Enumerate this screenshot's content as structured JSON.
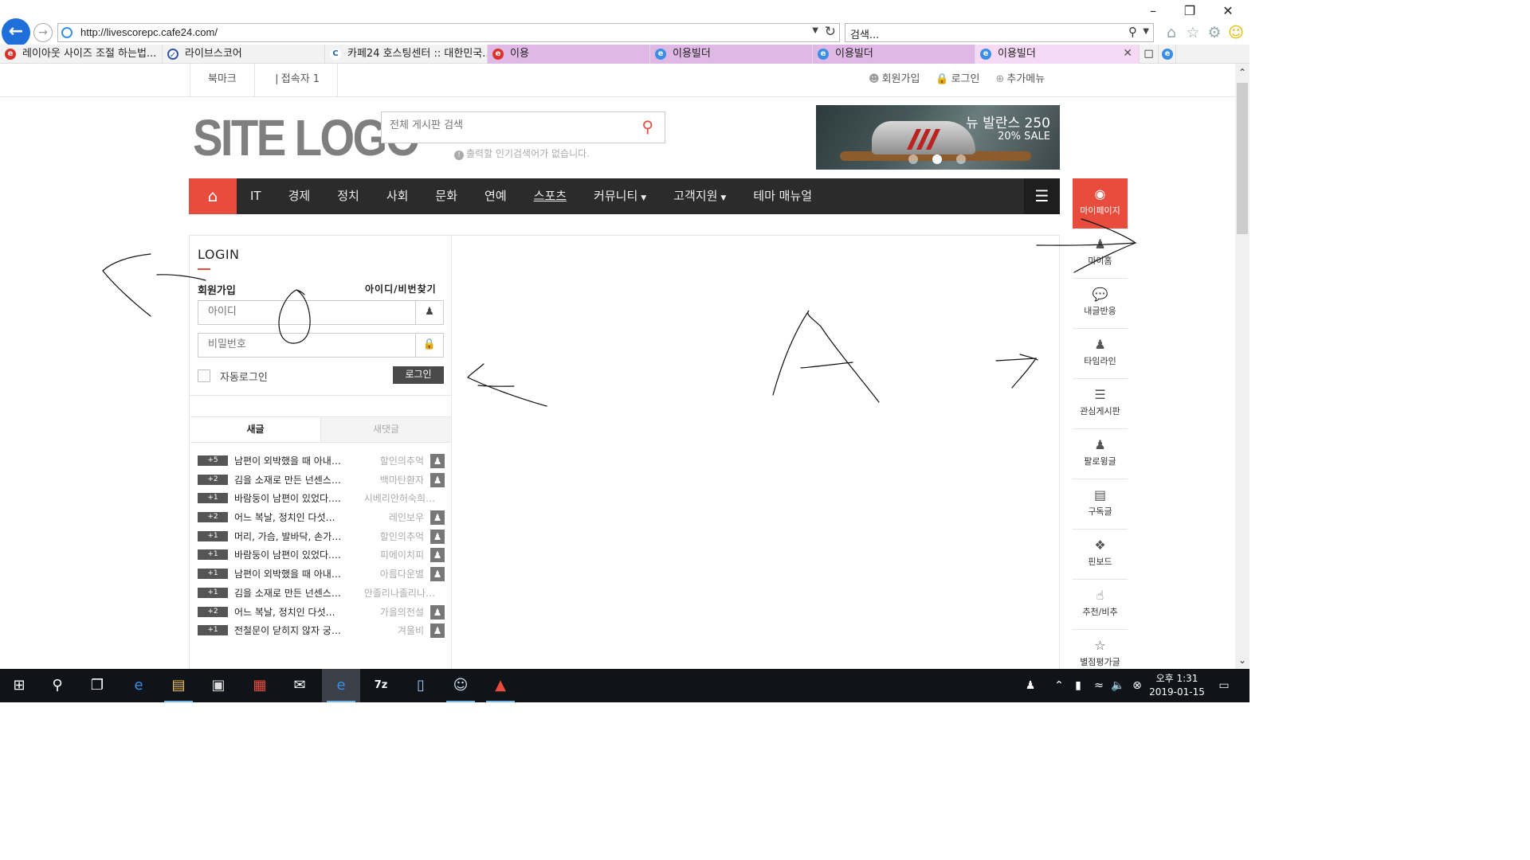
{
  "browser": {
    "url": "http://livescorepc.cafe24.com/",
    "search_placeholder": "검색...",
    "tabs": [
      {
        "label": "레이아웃 사이즈 조절 하는법..."
      },
      {
        "label": "라이브스코어"
      },
      {
        "label": "카페24 호스팅센터 :: 대한민국..."
      },
      {
        "label": "이용"
      },
      {
        "label": "이용빌더"
      },
      {
        "label": "이용빌더"
      },
      {
        "label": "이용빌더"
      }
    ]
  },
  "topbar": {
    "bookmark": "북마크",
    "visitors": "접속자 1",
    "join": "회원가입",
    "login": "로그인",
    "more_menu": "추가메뉴"
  },
  "header": {
    "logo": "SITE LOGO",
    "search_placeholder": "전체 게시판 검색",
    "popular_msg": "출력할 인기검색어가 없습니다.",
    "banner_title": "뉴 발란스 250",
    "banner_sub": "20% SALE"
  },
  "mainnav": {
    "items": [
      {
        "label": "IT"
      },
      {
        "label": "경제"
      },
      {
        "label": "정치"
      },
      {
        "label": "사회"
      },
      {
        "label": "문화"
      },
      {
        "label": "연예"
      },
      {
        "label": "스포츠"
      },
      {
        "label": "커뮤니티"
      },
      {
        "label": "고객지원"
      },
      {
        "label": "테마 매뉴얼"
      }
    ]
  },
  "login": {
    "title": "LOGIN",
    "join": "회원가입",
    "find": "아이디/비번찾기",
    "id_placeholder": "아이디",
    "pw_placeholder": "비밀번호",
    "auto_login": "자동로그인",
    "button": "로그인"
  },
  "post_tabs": {
    "new_posts": "새글",
    "new_comments": "새댓글"
  },
  "posts": [
    {
      "badge": "+5",
      "title": "남편이 외박했을 때 아내…",
      "author": "할인의추억"
    },
    {
      "badge": "+2",
      "title": "김을 소재로 만든 넌센스…",
      "author": "백마탄환자"
    },
    {
      "badge": "+1",
      "title": "바람둥이 남편이 있었다.…",
      "author": "시베리안허숙희…"
    },
    {
      "badge": "+2",
      "title": "어느 복날, 정치인 다섯…",
      "author": "레인보우"
    },
    {
      "badge": "+1",
      "title": "머리, 가슴, 발바닥, 손가…",
      "author": "할인의추억"
    },
    {
      "badge": "+1",
      "title": "바람둥이 남편이 있었다.…",
      "author": "피에이치피"
    },
    {
      "badge": "+1",
      "title": "남편이 외박했을 때 아내…",
      "author": "아름다운별"
    },
    {
      "badge": "+1",
      "title": "김을 소재로 만든 넌센스…",
      "author": "안졸리나졸리나…"
    },
    {
      "badge": "+2",
      "title": "어느 복날, 정치인 다섯…",
      "author": "가을의전설"
    },
    {
      "badge": "+1",
      "title": "전철문이 닫히지 않자 궁…",
      "author": "겨울비"
    }
  ],
  "quick_menu": [
    {
      "label": "마이페이지",
      "icon": "user-circle-icon"
    },
    {
      "label": "마이홈",
      "icon": "person-icon"
    },
    {
      "label": "내글반응",
      "icon": "speech-bubble-icon"
    },
    {
      "label": "타임라인",
      "icon": "user-clock-icon"
    },
    {
      "label": "관심게시판",
      "icon": "list-icon"
    },
    {
      "label": "팔로윙글",
      "icon": "user-plus-icon"
    },
    {
      "label": "구독글",
      "icon": "book-icon"
    },
    {
      "label": "핀보드",
      "icon": "pin-icon"
    },
    {
      "label": "추천/비추",
      "icon": "thumbs-up-icon"
    },
    {
      "label": "별점평가글",
      "icon": "star-icon"
    }
  ],
  "taskbar": {
    "time": "오후 1:31",
    "date": "2019-01-15"
  },
  "colors": {
    "accent": "#e74c3c",
    "nav_bg": "#2b2b2b",
    "logo": "#7f7f7f"
  }
}
